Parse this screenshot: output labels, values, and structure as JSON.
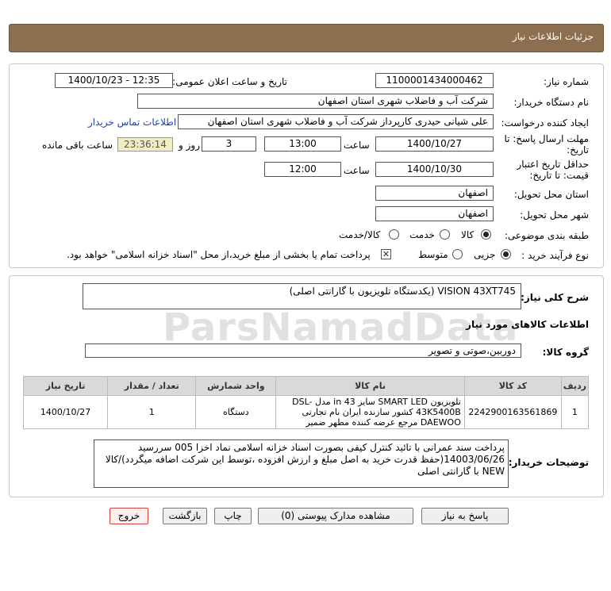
{
  "watermark": "ParsNamadData",
  "title": "جزئیات اطلاعات نیاز",
  "need": {
    "number_label": "شماره نیاز:",
    "number": "1100001434000462",
    "announce_label": "تاریخ و ساعت اعلان عمومی:",
    "announce_value": "1400/10/23 - 12:35",
    "buyer_org_label": "نام دستگاه خریدار:",
    "buyer_org": "شرکت آب و فاضلاب شهری استان اصفهان",
    "creator_label": "ایجاد کننده درخواست:",
    "creator": "علی شیانی حیدری کارپرداز شرکت آب و فاضلاب شهری استان اصفهان",
    "contact_link": "اطلاعات تماس خریدار",
    "deadline_label_1": "مهلت ارسال پاسخ: تا",
    "deadline_label_2": "تاریخ:",
    "deadline_date": "1400/10/27",
    "time_label": "ساعت",
    "deadline_time": "13:00",
    "days": "3",
    "days_label": "روز و",
    "remaining_time": "23:36:14",
    "remaining_label": "ساعت باقی مانده",
    "validity_label_1": "حداقل تاریخ اعتبار",
    "validity_label_2": "قیمت: تا تاریخ:",
    "validity_date": "1400/10/30",
    "validity_time": "12:00",
    "province_label": "استان محل تحویل:",
    "province": "اصفهان",
    "city_label": "شهر محل تحویل:",
    "city": "اصفهان",
    "category_label": "طبقه بندی موضوعی:",
    "category_options": [
      "کالا",
      "خدمت",
      "کالا/خدمت"
    ],
    "process_label": "نوع فرآیند خرید :",
    "process_options": [
      "جزیی",
      "متوسط"
    ],
    "payment_note": "پرداخت تمام یا بخشی از مبلغ خرید،از محل \"اسناد خزانه اسلامی\" خواهد بود."
  },
  "summary": {
    "label": "شرح کلی نیاز:",
    "value": "VISION 43XT745 (یکدستگاه تلویزیون با گارانتی اصلی)"
  },
  "goods_section": {
    "title": "اطلاعات کالاهای مورد نیاز",
    "group_label": "گروه کالا:",
    "group_value": "دوربین،صوتی و تصویر",
    "columns": [
      "ردیف",
      "کد کالا",
      "نام کالا",
      "واحد شمارش",
      "تعداد / مقدار",
      "تاریخ نیاز"
    ],
    "rows": [
      {
        "row": "1",
        "code": "2242900163561869",
        "name": "تلویزیون SMART LED سایز 43 in مدل DSL-43K5400B کشور سازنده ایران نام تجارتی DAEWOO مرجع عرضه کننده مطهر ضمیر",
        "unit": "دستگاه",
        "qty": "1",
        "date": "1400/10/27"
      }
    ]
  },
  "buyer_notes": {
    "label": "توضیحات خریدار:",
    "text": "پرداخت سند عمرانی با تائید کنترل کیفی بصورت اسناد خزانه اسلامی نماد اخزا 005 سررسید 14003/06/26(حفظ قدرت خرید به اصل مبلغ و ارزش افزوده ،توسط این شرکت اضافه میگردد)/کالا NEW با گارانتی اصلی"
  },
  "buttons": {
    "reply": "پاسخ به نیاز",
    "attachments": "مشاهده مدارک پیوستی (0)",
    "print": "چاپ",
    "back": "بازگشت",
    "exit": "خروج"
  }
}
